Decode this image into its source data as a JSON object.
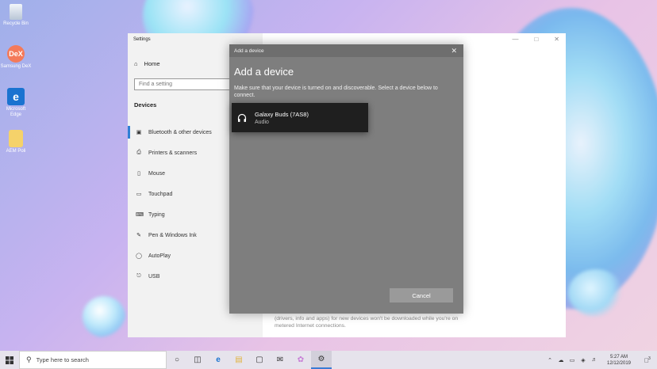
{
  "desktop": {
    "icons": [
      {
        "label": "Recycle Bin"
      },
      {
        "label": "Samsung DeX",
        "glyph": "DeX"
      },
      {
        "label": "Microsoft Edge",
        "glyph": "e"
      },
      {
        "label": "AEM Poli"
      }
    ]
  },
  "settings": {
    "title": "Settings",
    "home_label": "Home",
    "search_placeholder": "Find a setting",
    "section_title": "Devices",
    "nav_items": [
      {
        "label": "Bluetooth & other devices",
        "icon": "bluetooth-devices-icon"
      },
      {
        "label": "Printers & scanners",
        "icon": "printer-icon"
      },
      {
        "label": "Mouse",
        "icon": "mouse-icon"
      },
      {
        "label": "Touchpad",
        "icon": "touchpad-icon"
      },
      {
        "label": "Typing",
        "icon": "keyboard-icon"
      },
      {
        "label": "Pen & Windows Ink",
        "icon": "pen-icon"
      },
      {
        "label": "AutoPlay",
        "icon": "autoplay-icon"
      },
      {
        "label": "USB",
        "icon": "usb-icon"
      }
    ],
    "bottom_text": "(drivers, info and apps) for new devices won't be downloaded while you're on metered Internet connections."
  },
  "dialog": {
    "titlebar": "Add a device",
    "heading": "Add a device",
    "description": "Make sure that your device is turned on and discoverable. Select a device below to connect.",
    "device": {
      "name": "Galaxy Buds (7AS8)",
      "type": "Audio",
      "icon": "headphones-icon"
    },
    "cancel_label": "Cancel"
  },
  "taskbar": {
    "search_placeholder": "Type here to search",
    "time": "5:27 AM",
    "date": "12/12/2019",
    "notification_count": "3"
  },
  "colors": {
    "accent": "#2f7fd5",
    "dialog_bg": "#7e7e7e",
    "device_bg": "#1f1f1f"
  }
}
